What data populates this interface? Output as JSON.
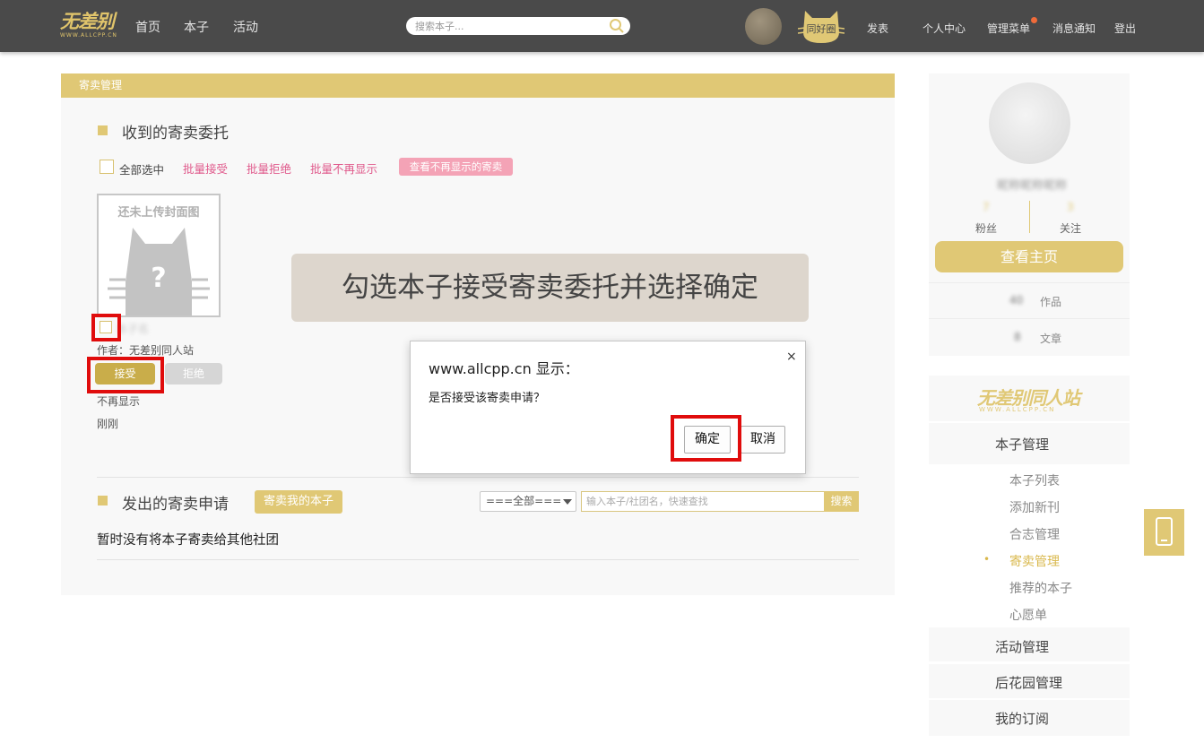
{
  "nav": {
    "logo_main": "无差别",
    "logo_sub": "WWW.ALLCPP.CN",
    "links": [
      "首页",
      "本子",
      "活动"
    ],
    "search_placeholder": "搜索本子...",
    "cat_badge": "同好圈",
    "right_links": [
      "发表",
      "个人中心",
      "管理菜单",
      "消息通知",
      "登出"
    ]
  },
  "panel": {
    "header": "寄卖管理",
    "received_title": "收到的寄卖委托",
    "select_all": "全部选中",
    "batch_accept": "批量接受",
    "batch_reject": "批量拒绝",
    "batch_hide": "批量不再显示",
    "view_hidden": "查看不再显示的寄卖",
    "cover_placeholder": "还未上传封面图",
    "book_name": "本子名",
    "author": "作者：无差别同人站",
    "accept": "接受",
    "reject": "拒绝",
    "hide": "不再显示",
    "time": "刚刚",
    "sent_title": "发出的寄卖申请",
    "consign_btn": "寄卖我的本子",
    "filter_select": "===全部===",
    "filter_placeholder": "输入本子/社团名，快速查找",
    "filter_search": "搜索",
    "empty_msg": "暂时没有将本子寄卖给其他社团"
  },
  "banner": "勾选本子接受寄卖委托并选择确定",
  "dialog": {
    "title": "www.allcpp.cn 显示：",
    "message": "是否接受该寄卖申请？",
    "close": "×",
    "ok": "确定",
    "cancel": "取消"
  },
  "sidebar": {
    "username": "昵称昵称昵称",
    "fans_count": "7",
    "fans_label": "粉丝",
    "follow_count": "3",
    "follow_label": "关注",
    "view_home": "查看主页",
    "works_count": "40",
    "works_label": "作品",
    "articles_count": "8",
    "articles_label": "文章",
    "brand": "无差别同人站",
    "brand_sub": "WWW.ALLCPP.CN",
    "menu": {
      "book_mgmt": "本子管理",
      "sub_items": [
        "本子列表",
        "添加新刊",
        "合志管理",
        "寄卖管理",
        "推荐的本子",
        "心愿单"
      ],
      "active_index": 3,
      "event_mgmt": "活动管理",
      "garden_mgmt": "后花园管理",
      "subscriptions": "我的订阅"
    }
  },
  "colors": {
    "nav_bg": "#4a4a4a",
    "accent": "#e0c875",
    "accept_btn": "#c9ad4a",
    "pink": "#e05a8c",
    "highlight_red": "#e00c0c"
  }
}
